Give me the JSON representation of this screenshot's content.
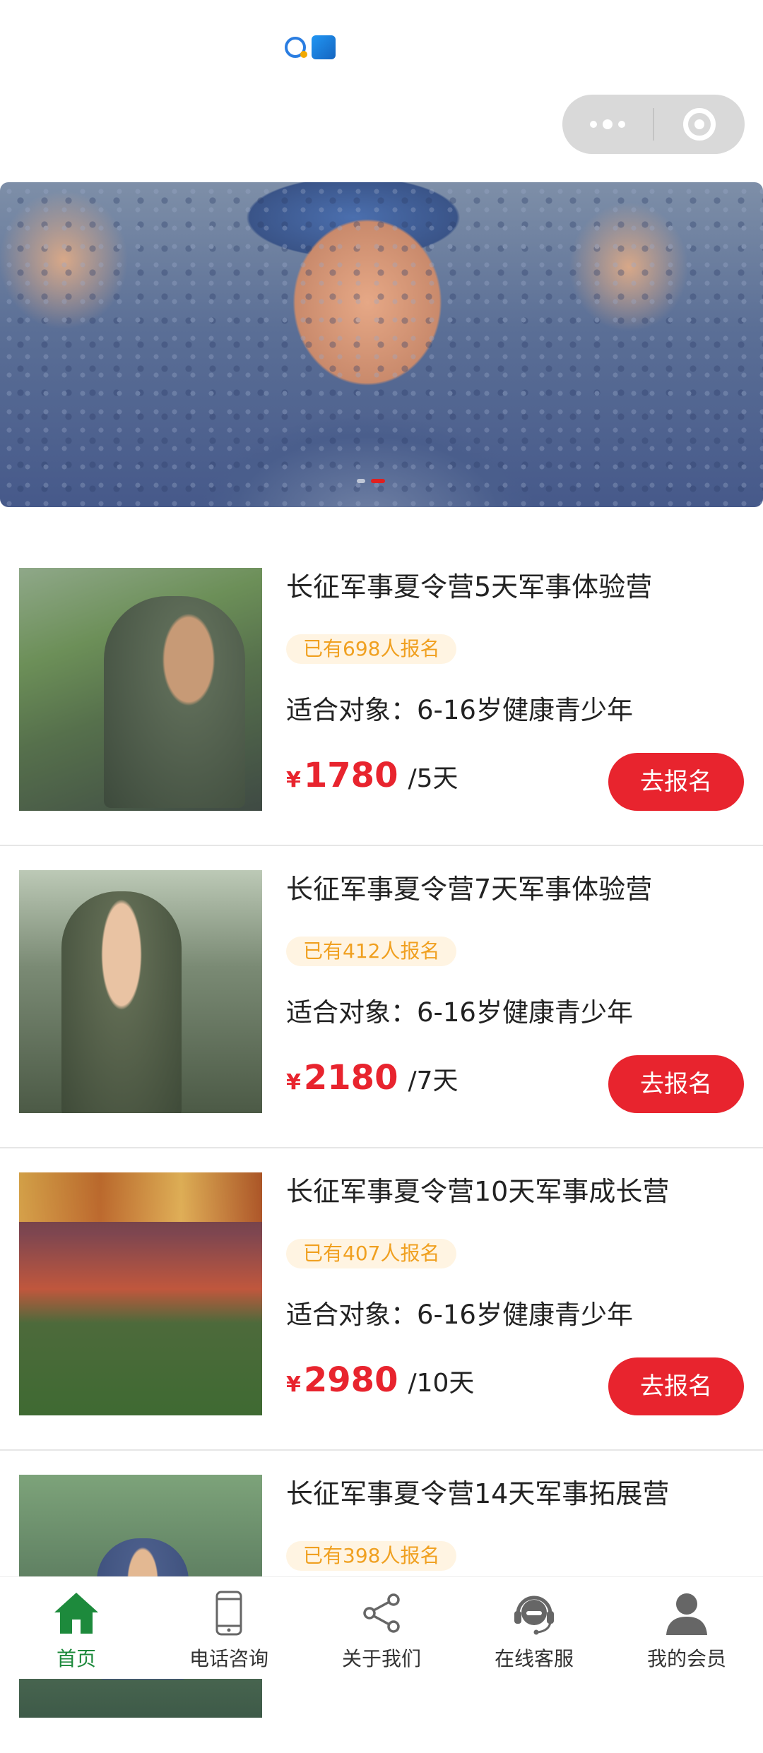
{
  "colors": {
    "accent": "#e8242e",
    "active_tab": "#1d8a3c",
    "badge_text": "#f0a020",
    "badge_bg": "#fff4e2"
  },
  "capsule": {
    "more_icon": "more-dots-icon",
    "close_icon": "target-circle-icon"
  },
  "banner": {
    "slide_count": 2,
    "active_slide": 2
  },
  "courses": [
    {
      "title": "长征军事夏令营5天军事体验营",
      "badge": "已有698人报名",
      "target": "适合对象：6-16岁健康青少年",
      "currency": "¥",
      "price": "1780",
      "unit": "/5天",
      "button": "去报名"
    },
    {
      "title": "长征军事夏令营7天军事体验营",
      "badge": "已有412人报名",
      "target": "适合对象：6-16岁健康青少年",
      "currency": "¥",
      "price": "2180",
      "unit": "/7天",
      "button": "去报名"
    },
    {
      "title": "长征军事夏令营10天军事成长营",
      "badge": "已有407人报名",
      "target": "适合对象：6-16岁健康青少年",
      "currency": "¥",
      "price": "2980",
      "unit": "/10天",
      "button": "去报名"
    },
    {
      "title": "长征军事夏令营14天军事拓展营",
      "badge": "已有398人报名"
    }
  ],
  "tabbar": [
    {
      "label": "首页",
      "icon": "home-icon",
      "active": true
    },
    {
      "label": "电话咨询",
      "icon": "phone-icon",
      "active": false
    },
    {
      "label": "关于我们",
      "icon": "share-icon",
      "active": false
    },
    {
      "label": "在线客服",
      "icon": "headset-icon",
      "active": false
    },
    {
      "label": "我的会员",
      "icon": "user-icon",
      "active": false
    }
  ]
}
